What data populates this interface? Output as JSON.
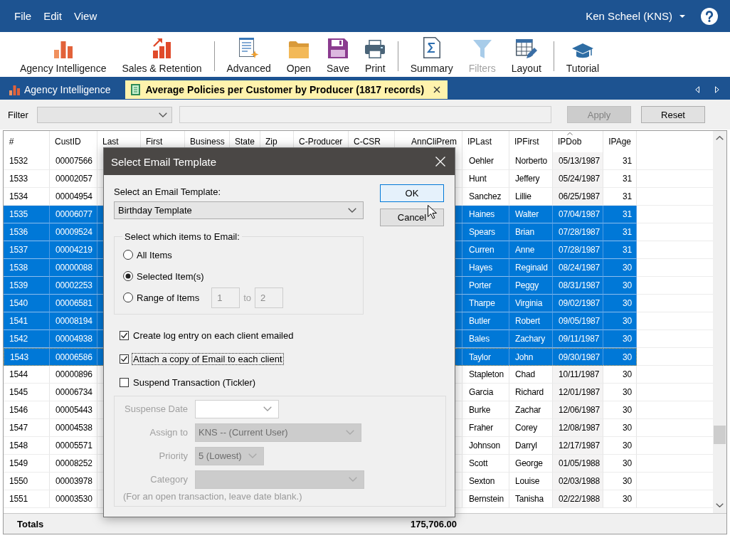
{
  "menu": {
    "items": [
      "File",
      "Edit",
      "View"
    ],
    "user": "Ken Scheel (KNS)"
  },
  "toolbar": {
    "groups": [
      [
        {
          "label": "Agency Intelligence",
          "disabled": false
        },
        {
          "label": "Sales & Retention",
          "disabled": false
        }
      ],
      [
        {
          "label": "Advanced",
          "disabled": false
        },
        {
          "label": "Open",
          "disabled": false
        },
        {
          "label": "Save",
          "disabled": false
        },
        {
          "label": "Print",
          "disabled": false
        }
      ],
      [
        {
          "label": "Summary",
          "disabled": false
        },
        {
          "label": "Filters",
          "disabled": true
        },
        {
          "label": "Layout",
          "disabled": false
        }
      ],
      [
        {
          "label": "Tutorial",
          "disabled": false
        }
      ]
    ]
  },
  "tabs": [
    {
      "label": "Agency Intelligence",
      "selected": false,
      "closable": false
    },
    {
      "label": "Average Policies per Customer by Producer (1817 records)",
      "selected": true,
      "closable": true
    }
  ],
  "filter_bar": {
    "label": "Filter",
    "buttons": [
      {
        "label": "Apply",
        "disabled": true
      },
      {
        "label": "Reset",
        "disabled": false
      }
    ]
  },
  "table": {
    "columns": [
      {
        "label": "#",
        "kind": "text",
        "sorted": false
      },
      {
        "label": "CustID",
        "kind": "text",
        "sorted": false
      },
      {
        "label": "Last",
        "kind": "text",
        "sorted": false
      },
      {
        "label": "First",
        "kind": "text",
        "sorted": false
      },
      {
        "label": "Business",
        "kind": "text",
        "sorted": false
      },
      {
        "label": "State",
        "kind": "text",
        "sorted": false
      },
      {
        "label": "Zip",
        "kind": "text",
        "sorted": false
      },
      {
        "label": "C-Producer",
        "kind": "text",
        "sorted": false
      },
      {
        "label": "C-CSR",
        "kind": "text",
        "sorted": false
      },
      {
        "label": "AnnCliPrem",
        "kind": "number",
        "sorted": false
      },
      {
        "label": "IPLast",
        "kind": "text",
        "sorted": false
      },
      {
        "label": "IPFirst",
        "kind": "text",
        "sorted": false
      },
      {
        "label": "IPDob",
        "kind": "text",
        "sorted": true
      },
      {
        "label": "IPAge",
        "kind": "number",
        "sorted": false
      }
    ],
    "rows": [
      {
        "number": "1532",
        "cust_id": "00007566",
        "ip_last": "Oehler",
        "ip_first": "Norberto",
        "ip_dob": "05/13/1987",
        "ip_age": "31",
        "selected": false,
        "focused": false
      },
      {
        "number": "1533",
        "cust_id": "00002057",
        "ip_last": "Hunt",
        "ip_first": "Jeffery",
        "ip_dob": "05/24/1987",
        "ip_age": "31",
        "selected": false,
        "focused": false
      },
      {
        "number": "1534",
        "cust_id": "00004954",
        "ip_last": "Sanchez",
        "ip_first": "Lillie",
        "ip_dob": "06/25/1987",
        "ip_age": "31",
        "selected": false,
        "focused": false
      },
      {
        "number": "1535",
        "cust_id": "00006077",
        "ip_last": "Haines",
        "ip_first": "Walter",
        "ip_dob": "07/04/1987",
        "ip_age": "31",
        "selected": true,
        "focused": false
      },
      {
        "number": "1536",
        "cust_id": "00009524",
        "ip_last": "Spears",
        "ip_first": "Brian",
        "ip_dob": "07/28/1987",
        "ip_age": "31",
        "selected": true,
        "focused": false
      },
      {
        "number": "1537",
        "cust_id": "00004219",
        "ip_last": "Curren",
        "ip_first": "Anne",
        "ip_dob": "07/28/1987",
        "ip_age": "31",
        "selected": true,
        "focused": false
      },
      {
        "number": "1538",
        "cust_id": "00000088",
        "ip_last": "Hayes",
        "ip_first": "Reginald",
        "ip_dob": "08/24/1987",
        "ip_age": "30",
        "selected": true,
        "focused": false
      },
      {
        "number": "1539",
        "cust_id": "00002253",
        "ip_last": "Porter",
        "ip_first": "Peggy",
        "ip_dob": "08/31/1987",
        "ip_age": "30",
        "selected": true,
        "focused": false
      },
      {
        "number": "1540",
        "cust_id": "00006581",
        "ip_last": "Tharpe",
        "ip_first": "Virginia",
        "ip_dob": "09/02/1987",
        "ip_age": "30",
        "selected": true,
        "focused": false
      },
      {
        "number": "1541",
        "cust_id": "00008194",
        "ip_last": "Butler",
        "ip_first": "Robert",
        "ip_dob": "09/05/1987",
        "ip_age": "30",
        "selected": true,
        "focused": false
      },
      {
        "number": "1542",
        "cust_id": "00004938",
        "ip_last": "Bales",
        "ip_first": "Zachary",
        "ip_dob": "09/11/1987",
        "ip_age": "30",
        "selected": true,
        "focused": false
      },
      {
        "number": "1543",
        "cust_id": "00006586",
        "ip_last": "Taylor",
        "ip_first": "John",
        "ip_dob": "09/30/1987",
        "ip_age": "30",
        "selected": true,
        "focused": true
      },
      {
        "number": "1544",
        "cust_id": "00000896",
        "ip_last": "Stapleton",
        "ip_first": "Chad",
        "ip_dob": "10/11/1987",
        "ip_age": "30",
        "selected": false,
        "focused": false
      },
      {
        "number": "1545",
        "cust_id": "00006734",
        "ip_last": "Garcia",
        "ip_first": "Richard",
        "ip_dob": "12/01/1987",
        "ip_age": "30",
        "selected": false,
        "focused": false
      },
      {
        "number": "1546",
        "cust_id": "00005443",
        "ip_last": "Burke",
        "ip_first": "Zachar",
        "ip_dob": "12/06/1987",
        "ip_age": "30",
        "selected": false,
        "focused": false
      },
      {
        "number": "1547",
        "cust_id": "00004538",
        "ip_last": "Fraher",
        "ip_first": "Corey",
        "ip_dob": "12/08/1987",
        "ip_age": "30",
        "selected": false,
        "focused": false
      },
      {
        "number": "1548",
        "cust_id": "00005571",
        "ip_last": "Johnson",
        "ip_first": "Darryl",
        "ip_dob": "12/17/1987",
        "ip_age": "30",
        "selected": false,
        "focused": false
      },
      {
        "number": "1549",
        "cust_id": "00008252",
        "ip_last": "Scott",
        "ip_first": "George",
        "ip_dob": "01/05/1988",
        "ip_age": "30",
        "selected": false,
        "focused": false
      },
      {
        "number": "1550",
        "cust_id": "00003978",
        "ip_last": "Sexton",
        "ip_first": "Louise",
        "ip_dob": "02/03/1988",
        "ip_age": "30",
        "selected": false,
        "focused": false
      },
      {
        "number": "1551",
        "cust_id": "00003530",
        "ip_last": "Bernstein",
        "ip_first": "Tanisha",
        "ip_dob": "02/22/1988",
        "ip_age": "30",
        "selected": false,
        "focused": false
      }
    ],
    "totals": {
      "label": "Totals",
      "ann_cli_prem": "175,706.00"
    }
  },
  "dialog": {
    "title": "Select Email Template",
    "template_label": "Select an Email Template:",
    "template_value": "Birthday Template",
    "buttons": [
      {
        "label": "OK",
        "default": true
      },
      {
        "label": "Cancel",
        "default": false
      }
    ],
    "items_group": {
      "legend": "Select which items to Email:",
      "options": [
        {
          "label": "All Items",
          "selected": false
        },
        {
          "label": "Selected Item(s)",
          "selected": true
        },
        {
          "label": "Range of Items",
          "selected": false
        }
      ],
      "range_from": "1",
      "range_to_label": "to",
      "range_to": "2"
    },
    "checkboxes": [
      {
        "label": "Create log entry on each client emailed",
        "checked": true,
        "focused": false
      },
      {
        "label": "Attach a copy of Email to each client",
        "checked": true,
        "focused": true
      },
      {
        "label": "Suspend Transaction (Tickler)",
        "checked": false,
        "focused": false
      }
    ],
    "tickler": {
      "fields": [
        {
          "label": "Suspense Date",
          "kind": "date"
        },
        {
          "label": "Assign to",
          "kind": "select",
          "value": "KNS -- (Current User)"
        },
        {
          "label": "Priority",
          "kind": "select",
          "value": "5 (Lowest)"
        },
        {
          "label": "Category",
          "kind": "select"
        }
      ],
      "note": "(For an open transaction, leave date blank.)"
    }
  }
}
